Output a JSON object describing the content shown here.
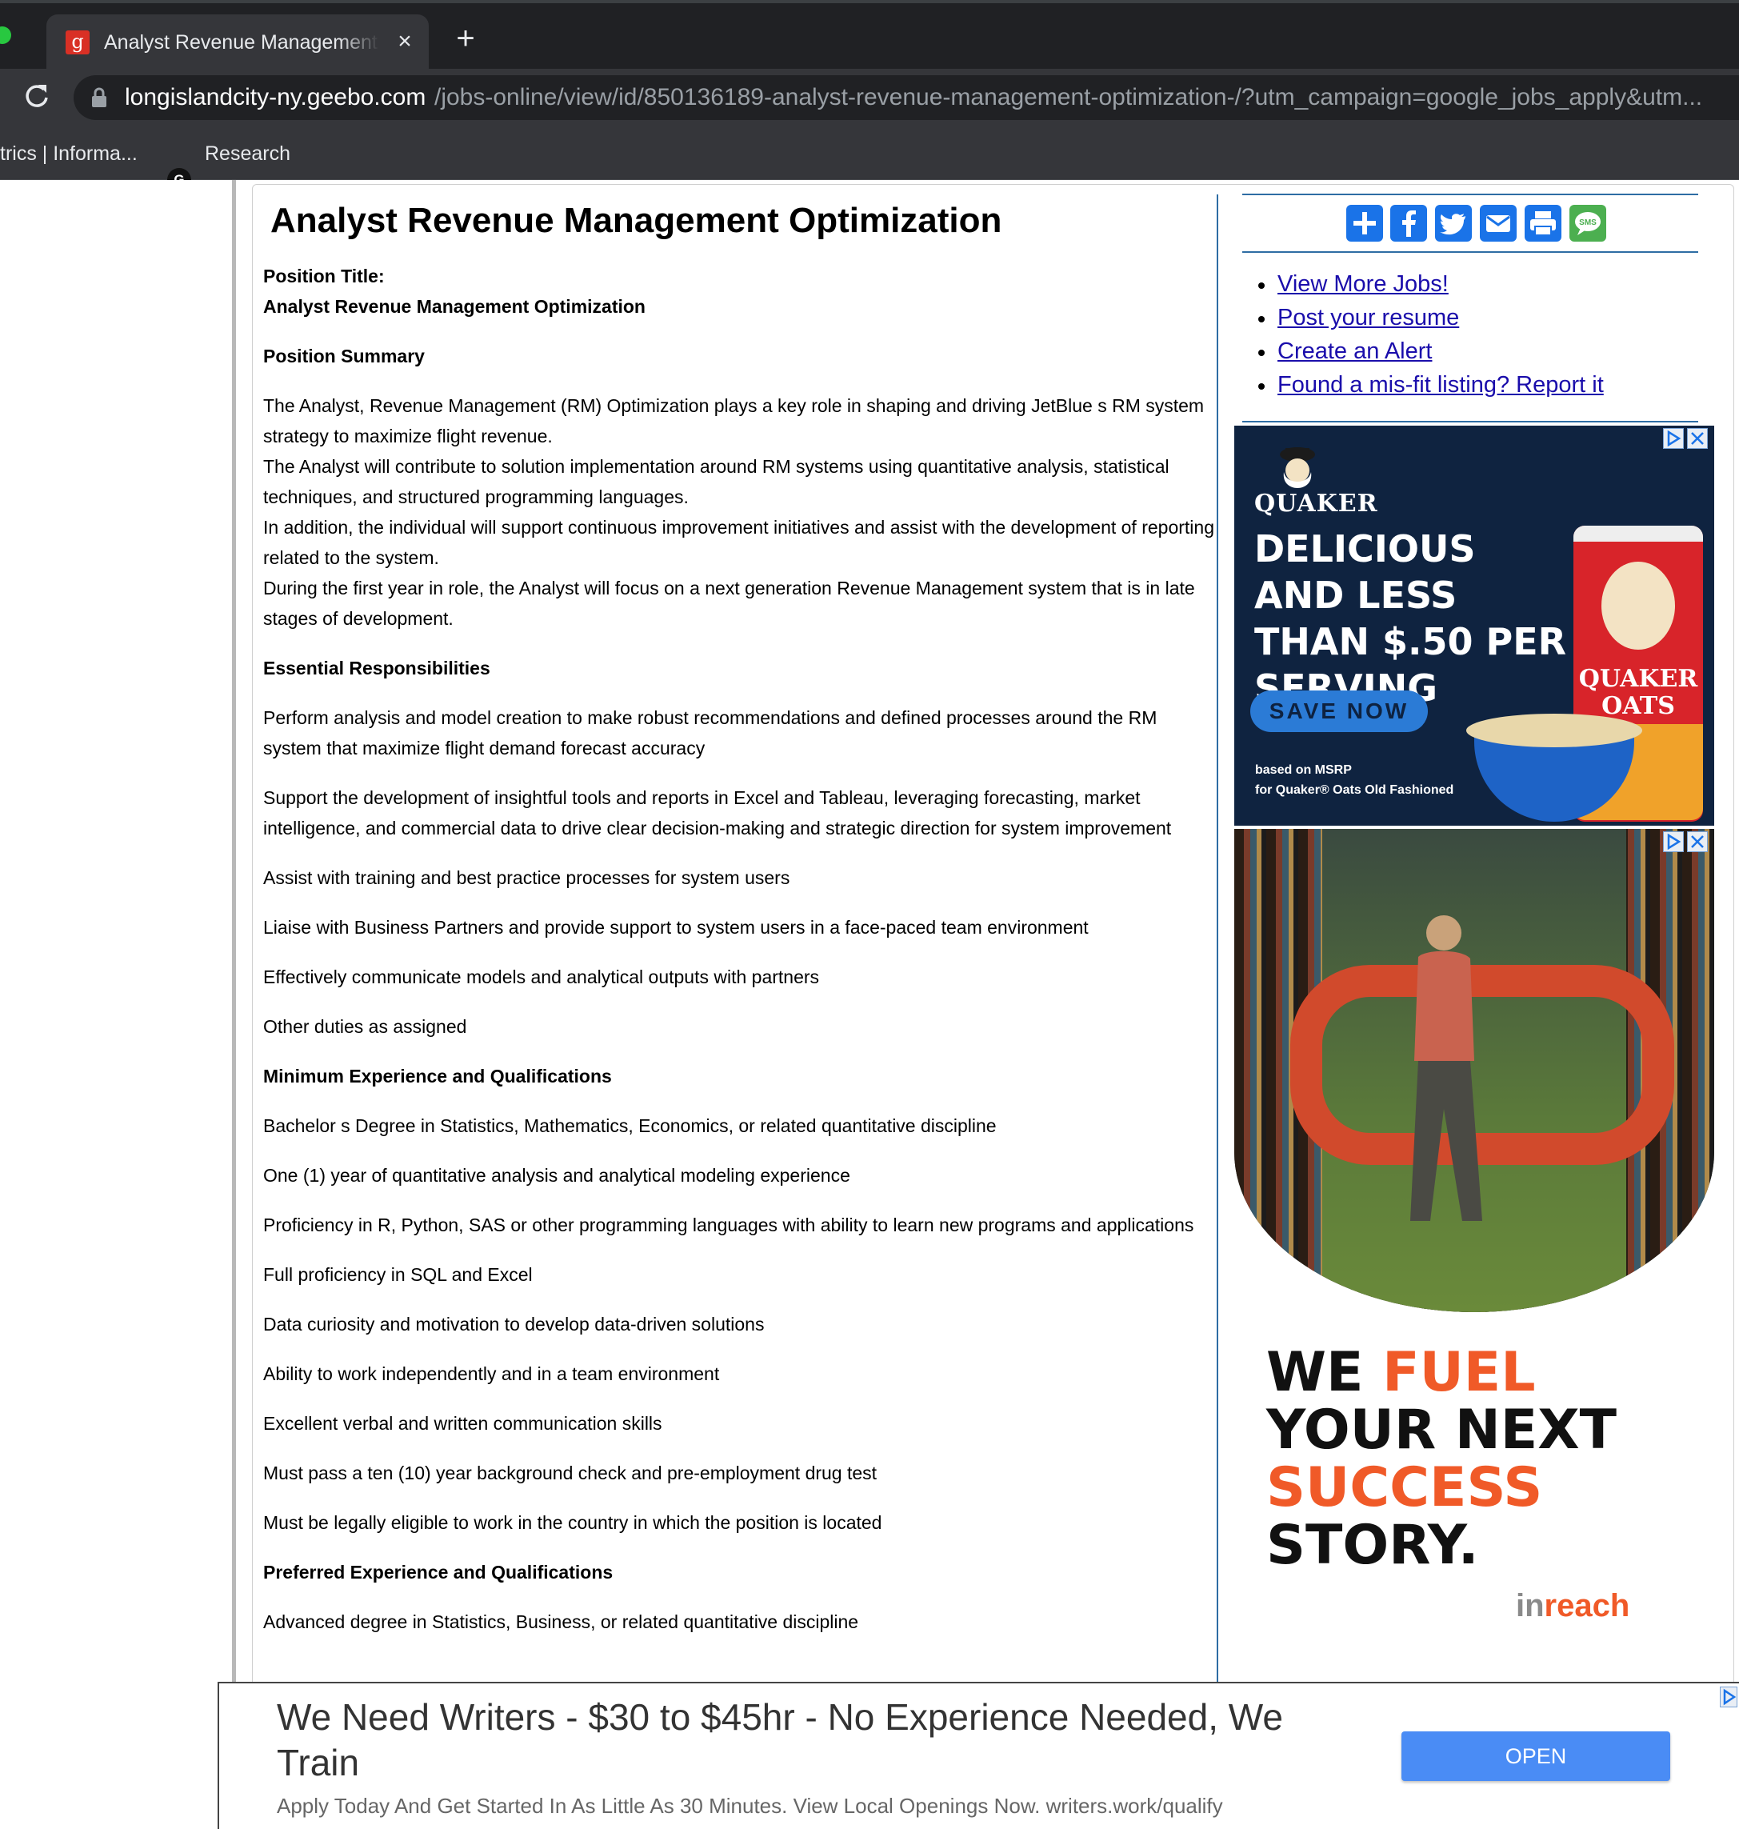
{
  "browser": {
    "tab_title": "Analyst Revenue Management Optimization",
    "url_host": "longislandcity-ny.geebo.com",
    "url_path": "/jobs-online/view/id/850136189-analyst-revenue-management-optimization-/?utm_campaign=google_jobs_apply&utm...",
    "bookmarks": [
      "trics | Informa...",
      "Research"
    ],
    "bookmark_icon_letter": "G"
  },
  "job": {
    "title": "Analyst Revenue Management Optimization",
    "position_title_label": "Position Title:",
    "position_title_value": "Analyst Revenue Management Optimization",
    "summary_heading": "Position Summary",
    "summary_paragraphs": [
      "The Analyst, Revenue Management (RM) Optimization plays a key role in shaping and driving JetBlue s RM system strategy to maximize flight revenue.",
      "The Analyst will contribute to solution implementation around RM systems using quantitative analysis, statistical techniques, and structured programming languages.",
      "In addition, the individual will support continuous improvement initiatives and assist with the development of reporting related to the system.",
      "During the first year in role, the Analyst will focus on a next generation Revenue Management system that is in late stages of development."
    ],
    "responsibilities_heading": "Essential Responsibilities",
    "responsibilities": [
      "Perform analysis and model creation to make robust recommendations and defined processes around the RM system that maximize flight demand forecast accuracy",
      "Support the development of insightful tools and reports in Excel and Tableau, leveraging forecasting, market intelligence, and commercial data to drive clear decision-making and strategic direction for system improvement",
      "Assist with training and best practice processes for system users",
      "Liaise with Business Partners and provide support to system users in a face-paced team environment",
      "Effectively communicate models and analytical outputs with partners",
      "Other duties as assigned"
    ],
    "min_heading": "Minimum Experience and Qualifications",
    "min_qualifications": [
      "Bachelor s Degree in Statistics, Mathematics, Economics, or related quantitative discipline",
      "One (1) year of quantitative analysis and analytical modeling experience",
      "Proficiency in R, Python, SAS or other programming languages with ability to learn new programs and applications",
      "Full proficiency in SQL and Excel",
      "Data curiosity and motivation to develop data-driven solutions",
      "Ability to work independently and in a team environment",
      "Excellent verbal and written communication skills",
      "Must pass a ten (10) year background check and pre-employment drug test",
      "Must be legally eligible to work in the country in which the position is located"
    ],
    "pref_heading": "Preferred Experience and Qualifications",
    "pref_qualifications": [
      "Advanced degree in Statistics, Business, or related quantitative discipline"
    ]
  },
  "sidebar": {
    "share_icons": [
      "plus-icon",
      "facebook-icon",
      "twitter-icon",
      "email-icon",
      "print-icon",
      "sms-icon"
    ],
    "sms_label": "SMS",
    "links": [
      "View More Jobs!",
      "Post your resume",
      "Create an Alert",
      "Found a mis-fit listing? Report it"
    ]
  },
  "ads": {
    "quaker": {
      "brand": "QUAKER",
      "headline": "DELICIOUS AND LESS THAN $.50 PER SERVING",
      "cta": "SAVE NOW",
      "fine_print_1": "based on MSRP",
      "fine_print_2": "for Quaker® Oats Old Fashioned",
      "canister_label": "QUAKER OATS"
    },
    "inreach": {
      "line1_a": "WE ",
      "line1_b": "FUEL",
      "line2": "YOUR NEXT",
      "line3": "SUCCESS",
      "line4": "STORY.",
      "logo_a": "in",
      "logo_b": "reach"
    },
    "banner": {
      "title": "We Need Writers - $30 to $45hr - No Experience Needed, We Train",
      "description": "Apply Today And Get Started In As Little As 30 Minutes. View Local Openings Now. writers.work/qualify",
      "button": "OPEN"
    }
  },
  "colors": {
    "link": "#1a0dab",
    "share_blue": "#1a73e8",
    "divider_blue": "#2e6da4",
    "inreach_orange": "#f05a28",
    "banner_button": "#4a8cf5"
  }
}
